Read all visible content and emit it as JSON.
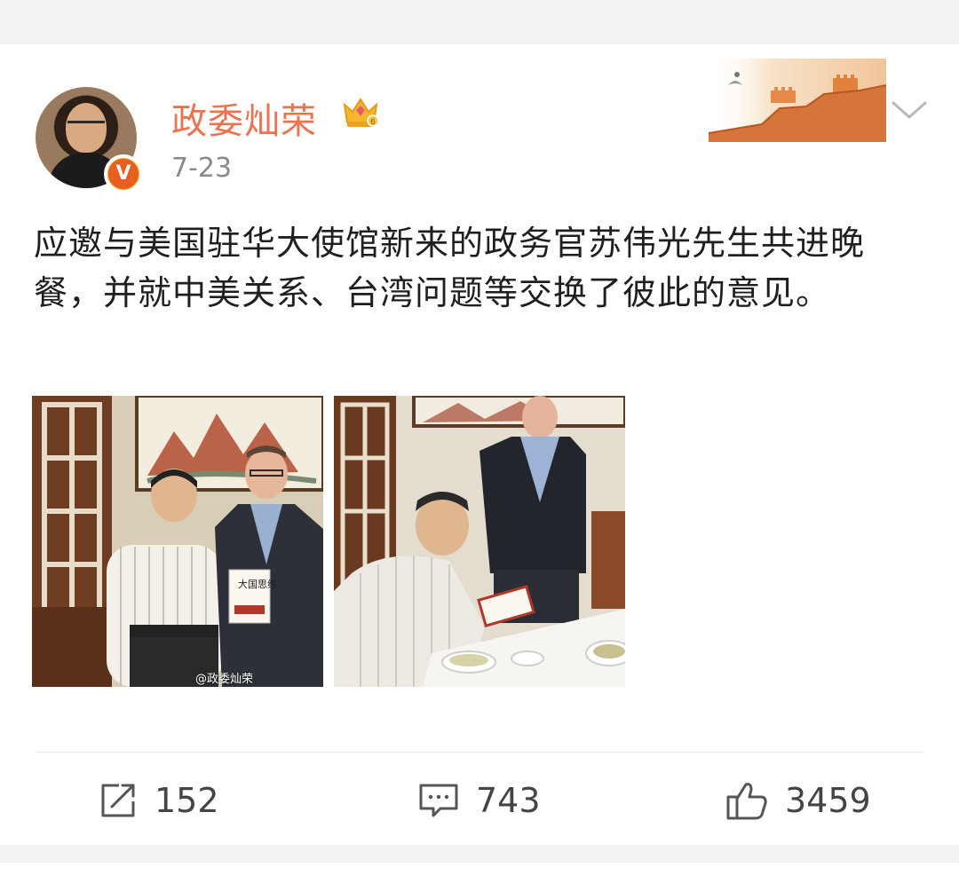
{
  "post": {
    "username": "政委灿荣",
    "date": "7-23",
    "text": "应邀与美国驻华大使馆新来的政务官苏伟光先生共进晚餐，并就中美关系、台湾问题等交换了彼此的意见。",
    "verified_badge": "V",
    "images": [
      {
        "watermark": "@政委灿荣",
        "icon": "photo-two-men-holding-book"
      },
      {
        "watermark": "",
        "icon": "photo-man-signing-book"
      }
    ],
    "book_title_chars": "大国思维"
  },
  "actions": {
    "repost_count": "152",
    "comment_count": "743",
    "like_count": "3459"
  },
  "icons": {
    "vip": "crown-icon",
    "menu": "chevron-down-icon",
    "repost": "repost-icon",
    "comment": "comment-icon",
    "like": "thumbs-up-icon",
    "card_decoration": "great-wall-icon"
  },
  "colors": {
    "username": "#eb7350",
    "badge": "#f5a623",
    "text": "#1f1f1f",
    "meta": "#8a8a8a"
  }
}
